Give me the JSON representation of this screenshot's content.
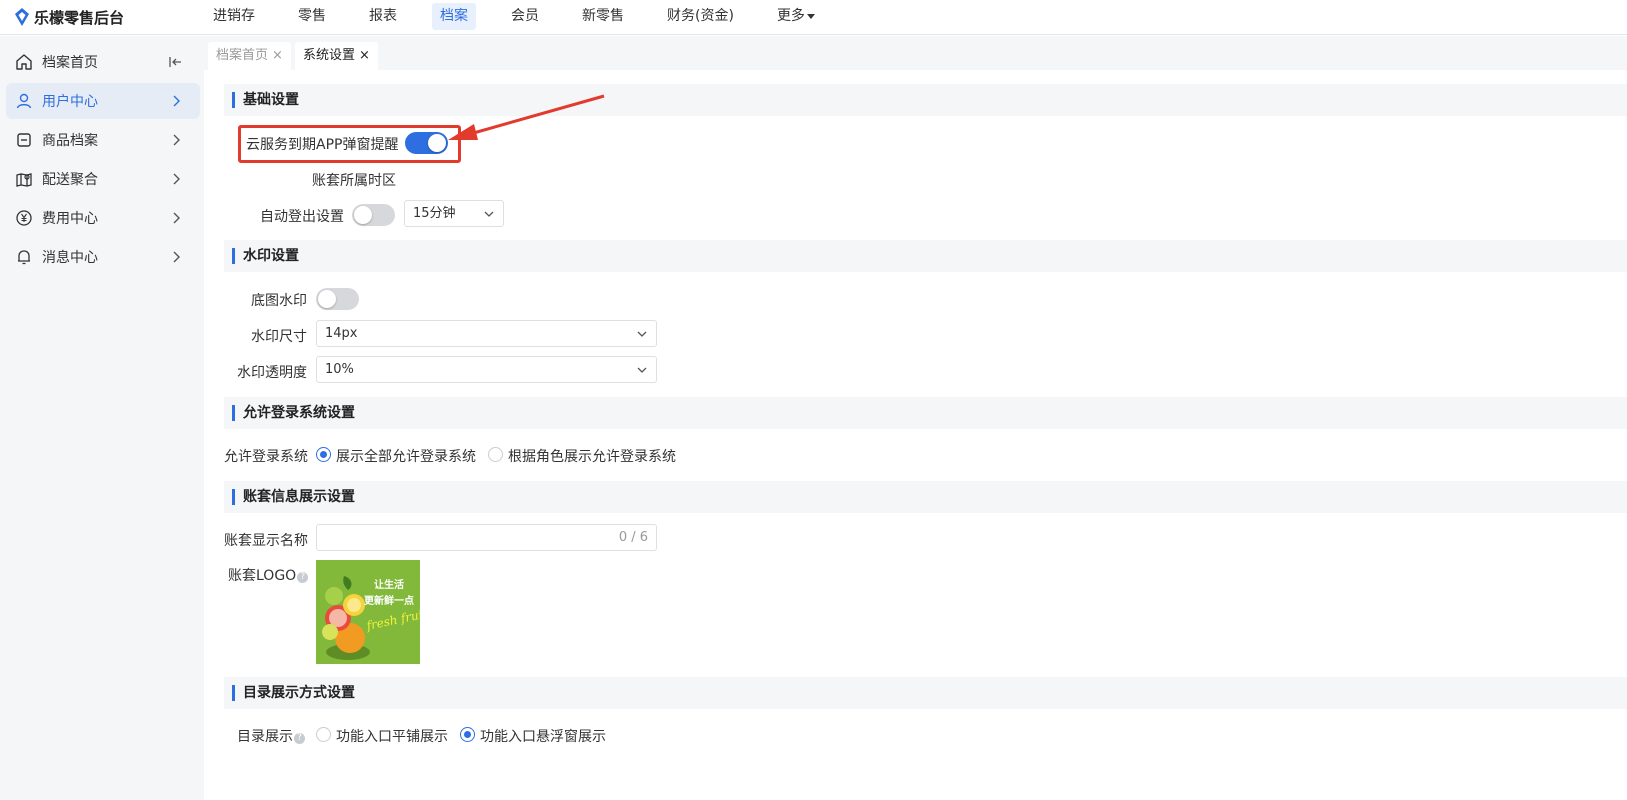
{
  "app": {
    "title": "乐檬零售后台"
  },
  "topnav": {
    "items": [
      {
        "label": "进销存",
        "active": false
      },
      {
        "label": "零售",
        "active": false
      },
      {
        "label": "报表",
        "active": false
      },
      {
        "label": "档案",
        "active": true
      },
      {
        "label": "会员",
        "active": false
      },
      {
        "label": "新零售",
        "active": false
      },
      {
        "label": "财务(资金)",
        "active": false
      },
      {
        "label": "更多",
        "active": false
      }
    ]
  },
  "sidebar": {
    "items": [
      {
        "label": "档案首页",
        "icon": "home-icon",
        "active": false
      },
      {
        "label": "用户中心",
        "icon": "user-icon",
        "active": true
      },
      {
        "label": "商品档案",
        "icon": "box-icon",
        "active": false
      },
      {
        "label": "配送聚合",
        "icon": "map-pin-icon",
        "active": false
      },
      {
        "label": "费用中心",
        "icon": "yen-icon",
        "active": false
      },
      {
        "label": "消息中心",
        "icon": "bell-icon",
        "active": false
      }
    ]
  },
  "tabs": [
    {
      "label": "档案首页",
      "close": "×",
      "active": false
    },
    {
      "label": "系统设置",
      "close": "×",
      "active": true
    }
  ],
  "basic": {
    "title": "基础设置",
    "cloud_label": "云服务到期APP弹窗提醒",
    "cloud_on": true,
    "timezone_label": "账套所属时区",
    "autologout_label": "自动登出设置",
    "autologout_on": false,
    "autologout_value": "15分钟"
  },
  "watermark": {
    "title": "水印设置",
    "bg_label": "底图水印",
    "bg_on": false,
    "size_label": "水印尺寸",
    "size_value": "14px",
    "opacity_label": "水印透明度",
    "opacity_value": "10%"
  },
  "login": {
    "title": "允许登录系统设置",
    "label": "允许登录系统",
    "options": [
      {
        "label": "展示全部允许登录系统",
        "checked": true
      },
      {
        "label": "根据角色展示允许登录系统",
        "checked": false
      }
    ]
  },
  "account": {
    "title": "账套信息展示设置",
    "name_label": "账套显示名称",
    "name_count": "0 / 6",
    "logo_label": "账套LOGO",
    "logo_text_line1": "让生活",
    "logo_text_line2": "更新鲜一点",
    "logo_text_line3": "fresh fruits"
  },
  "catalog": {
    "title": "目录展示方式设置",
    "label": "目录展示",
    "options": [
      {
        "label": "功能入口平铺展示",
        "checked": false
      },
      {
        "label": "功能入口悬浮窗展示",
        "checked": true
      }
    ]
  },
  "colors": {
    "accent": "#2d6fe0",
    "annotation": "#e23b2e"
  }
}
